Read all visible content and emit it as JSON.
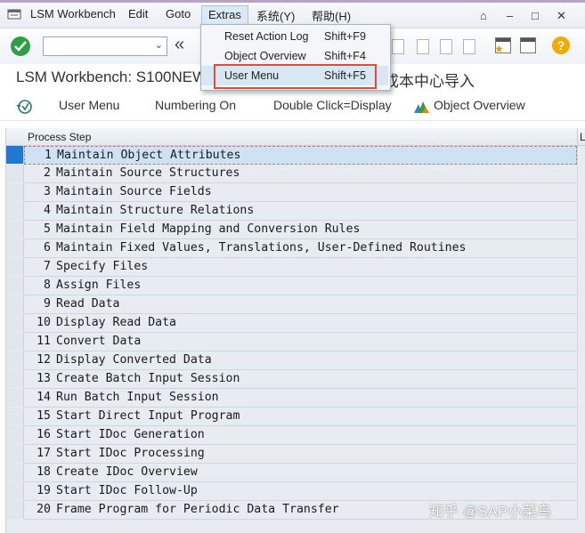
{
  "menubar": {
    "items": [
      "LSM Workbench",
      "Edit",
      "Goto",
      "Extras",
      "系统(Y)",
      "帮助(H)"
    ],
    "window_controls": [
      "⌂",
      "–",
      "□",
      "✕"
    ]
  },
  "toolbar": {
    "command_field_value": "",
    "command_field_placeholder": "",
    "help_label": "?"
  },
  "title": {
    "text": "LSM Workbench: S100NEW,",
    "suffix": "成本中心导入"
  },
  "app_toolbar": {
    "user_menu": "User Menu",
    "numbering_on": "Numbering On",
    "double_click": "Double Click=Display",
    "object_overview": "Object Overview"
  },
  "extras_menu": {
    "items": [
      {
        "label": "Reset Action Log",
        "shortcut": "Shift+F9"
      },
      {
        "label": "Object Overview",
        "shortcut": "Shift+F4"
      },
      {
        "label": "User Menu",
        "shortcut": "Shift+F5"
      }
    ]
  },
  "table": {
    "column_header": "Process Step",
    "column_header_2": "L",
    "rows": [
      {
        "num": "1",
        "label": "Maintain Object Attributes"
      },
      {
        "num": "2",
        "label": "Maintain Source Structures"
      },
      {
        "num": "3",
        "label": "Maintain Source Fields"
      },
      {
        "num": "4",
        "label": "Maintain Structure Relations"
      },
      {
        "num": "5",
        "label": "Maintain Field Mapping and Conversion Rules"
      },
      {
        "num": "6",
        "label": "Maintain Fixed Values, Translations, User-Defined Routines"
      },
      {
        "num": "7",
        "label": "Specify Files"
      },
      {
        "num": "8",
        "label": "Assign Files"
      },
      {
        "num": "9",
        "label": "Read Data"
      },
      {
        "num": "10",
        "label": "Display Read Data"
      },
      {
        "num": "11",
        "label": "Convert Data"
      },
      {
        "num": "12",
        "label": "Display Converted Data"
      },
      {
        "num": "13",
        "label": "Create Batch Input Session"
      },
      {
        "num": "14",
        "label": "Run Batch Input Session"
      },
      {
        "num": "15",
        "label": "Start Direct Input Program"
      },
      {
        "num": "16",
        "label": "Start IDoc Generation"
      },
      {
        "num": "17",
        "label": "Start IDoc Processing"
      },
      {
        "num": "18",
        "label": "Create IDoc Overview"
      },
      {
        "num": "19",
        "label": "Start IDoc Follow-Up"
      },
      {
        "num": "20",
        "label": "Frame Program for Periodic Data Transfer"
      }
    ]
  },
  "watermark": "知乎 @SAP小菜鸟",
  "colors": {
    "accent_green": "#2f9e44",
    "selection_blue": "#1f78d1",
    "highlight_red": "#e34a2f",
    "help_orange": "#f2a900"
  }
}
